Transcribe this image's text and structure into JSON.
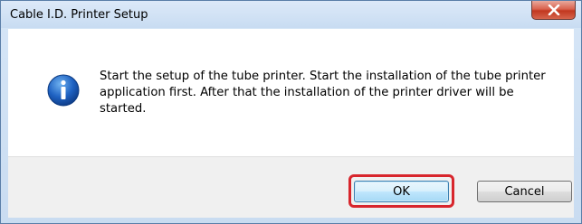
{
  "window": {
    "title": "Cable I.D. Printer Setup"
  },
  "dialog": {
    "message": "Start the setup of the tube printer. Start the installation of the tube printer application first. After that the installation of the printer driver will be started.",
    "icon": "info-icon"
  },
  "buttons": {
    "ok_label": "OK",
    "cancel_label": "Cancel"
  },
  "colors": {
    "highlight": "#d8262d",
    "close_button": "#c2381f"
  }
}
